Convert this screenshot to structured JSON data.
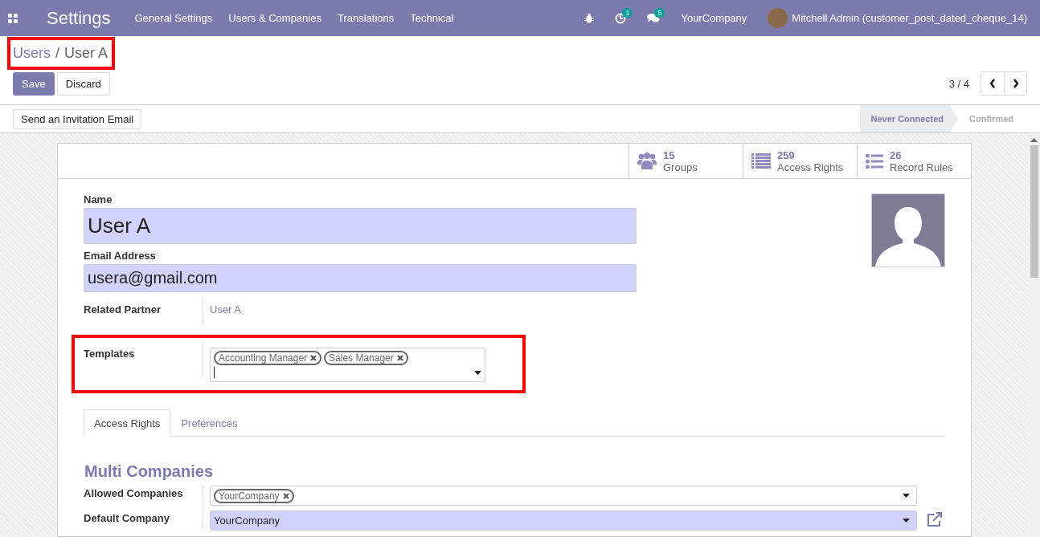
{
  "navbar": {
    "app_title": "Settings",
    "menu": [
      "General Settings",
      "Users & Companies",
      "Translations",
      "Technical"
    ],
    "activity_count": "1",
    "message_count": "5",
    "company": "YourCompany",
    "user": "Mitchell Admin (customer_post_dated_cheque_14)"
  },
  "breadcrumb": [
    {
      "label": "Users"
    },
    {
      "label": "User A"
    }
  ],
  "breadcrumb_separator": "/",
  "actions": {
    "save": "Save",
    "discard": "Discard"
  },
  "pager": "3 / 4",
  "header_button": "Send an Invitation Email",
  "statuses": [
    {
      "label": "Never Connected",
      "selected": true
    },
    {
      "label": "Confirmed",
      "selected": false
    }
  ],
  "smart_buttons": [
    {
      "kind": "groups",
      "count": "15",
      "label": "Groups"
    },
    {
      "kind": "list",
      "count": "259",
      "label": "Access Rights"
    },
    {
      "kind": "rules",
      "count": "26",
      "label": "Record Rules"
    }
  ],
  "form": {
    "name_label": "Name",
    "name": "User A",
    "email_label": "Email Address",
    "email": "usera@gmail.com",
    "related_partner": {
      "label": "Related Partner",
      "value": "User A"
    },
    "templates": {
      "label": "Templates",
      "tags": [
        "Accounting Manager",
        "Sales Manager"
      ]
    }
  },
  "tabs": [
    {
      "label": "Access Rights",
      "selected": true
    },
    {
      "label": "Preferences",
      "selected": false
    }
  ],
  "section": {
    "title": "Multi Companies",
    "allowed_label": "Allowed Companies",
    "allowed_tags": [
      "YourCompany"
    ],
    "default_label": "Default Company",
    "default_value": "YourCompany"
  }
}
